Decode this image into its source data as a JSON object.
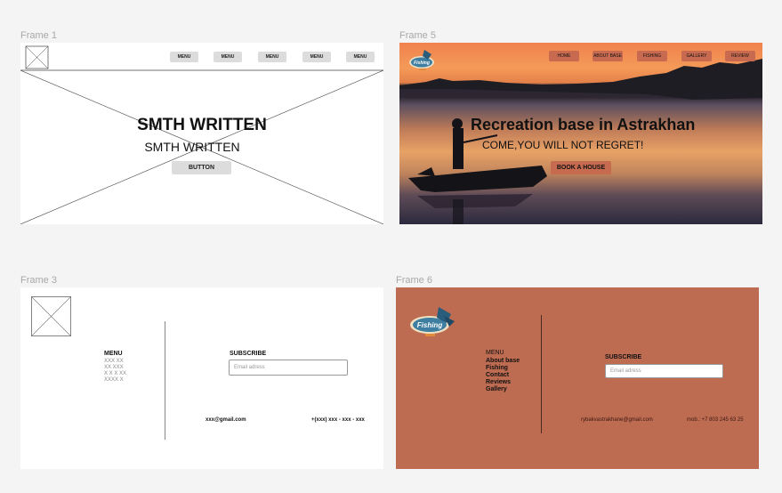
{
  "frames": {
    "f1": {
      "label": "Frame 1",
      "menu": [
        "MENU",
        "MENU",
        "MENU",
        "MENU",
        "MENU"
      ],
      "heading": "SMTH WRITTEN",
      "subheading": "SMTH WRITTEN",
      "button": "BUTTON"
    },
    "f5": {
      "label": "Frame 5",
      "nav": [
        "HOME",
        "ABOUT BASE",
        "FISHING",
        "GALLERY",
        "REVIEW"
      ],
      "logo_text": "Fishing",
      "title": "Recreation base in Astrakhan",
      "subtitle": "COME,YOU WILL NOT REGRET!",
      "button": "BOOK A HOUSE"
    },
    "f3": {
      "label": "Frame 3",
      "menu_title": "MENU",
      "menu_items": [
        "XXX XX",
        "XX XXX",
        "X X X XX",
        "XXXX X"
      ],
      "subscribe_title": "SUBSCRIBE",
      "email_placeholder": "Email adress",
      "email": "xxx@gmail.com",
      "phone": "+(xxx) xxx - xxx - xxx"
    },
    "f6": {
      "label": "Frame 6",
      "logo_text": "Fishing",
      "menu_title": "MENU",
      "menu_items": [
        "About base",
        "Fishing",
        "Contact",
        "Reviews",
        "Gallery"
      ],
      "subscribe_title": "SUBSCRIBE",
      "email_placeholder": "Email adress",
      "email": "rybakvastrakhane@gmail.com",
      "phone": "mob.: +7 803 245 63 25"
    }
  },
  "colors": {
    "canvas_bg": "#f4f4f4",
    "terracotta": "#bd6b51",
    "nav_button": "#c76a50",
    "wire_grey": "#dcdcdc"
  }
}
